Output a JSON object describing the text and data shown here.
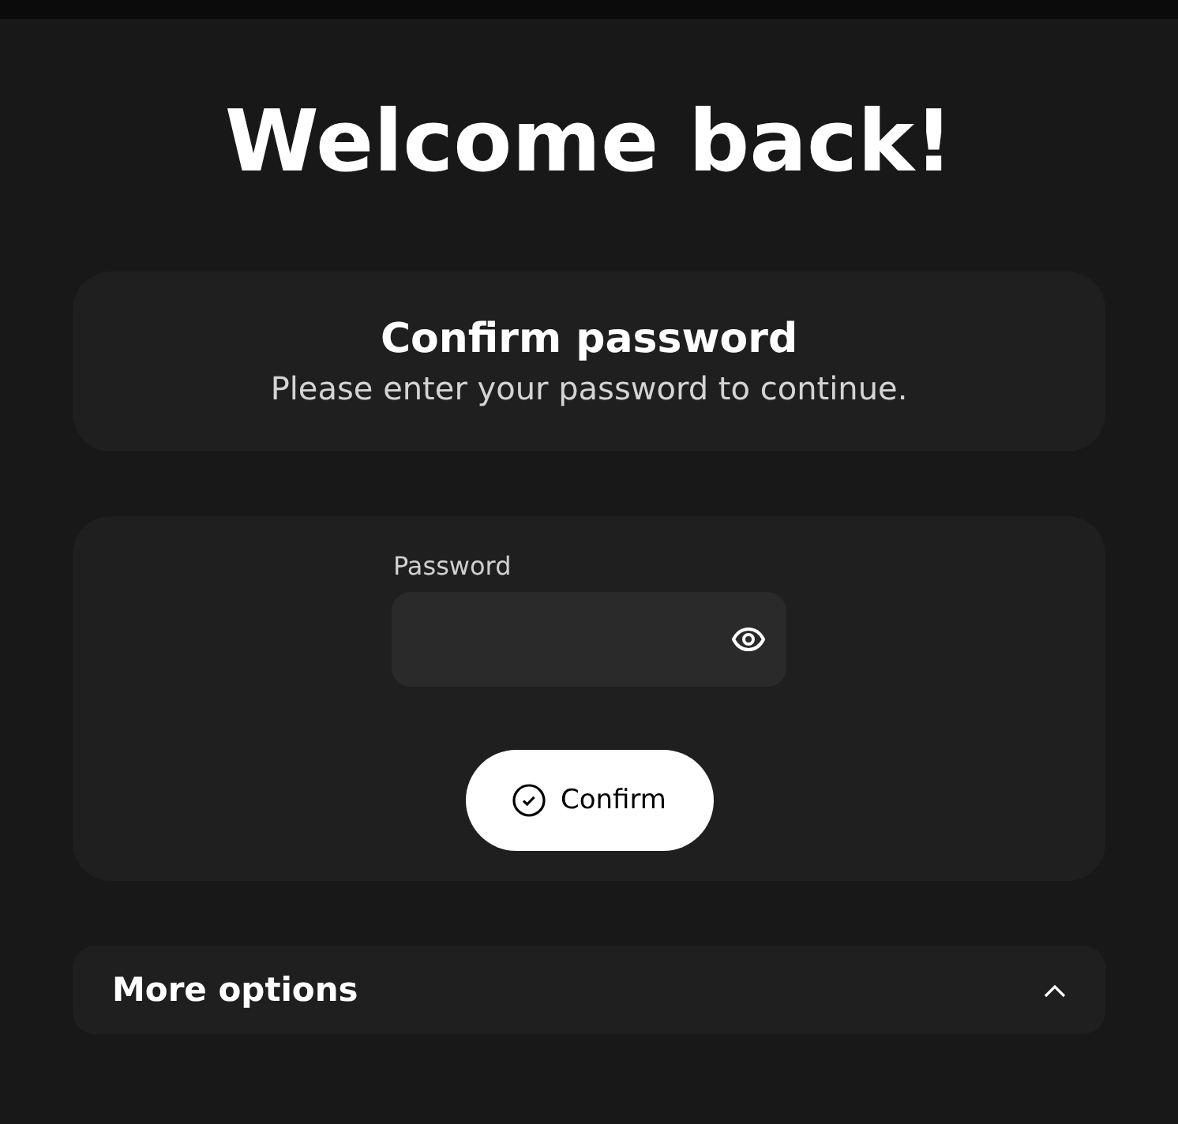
{
  "title": "Welcome back!",
  "header_card": {
    "heading": "Confirm password",
    "message": "Please enter your password to continue."
  },
  "password_form": {
    "label": "Password",
    "confirm_button": "Confirm"
  },
  "more_options": {
    "label": "More options",
    "expanded": true
  }
}
